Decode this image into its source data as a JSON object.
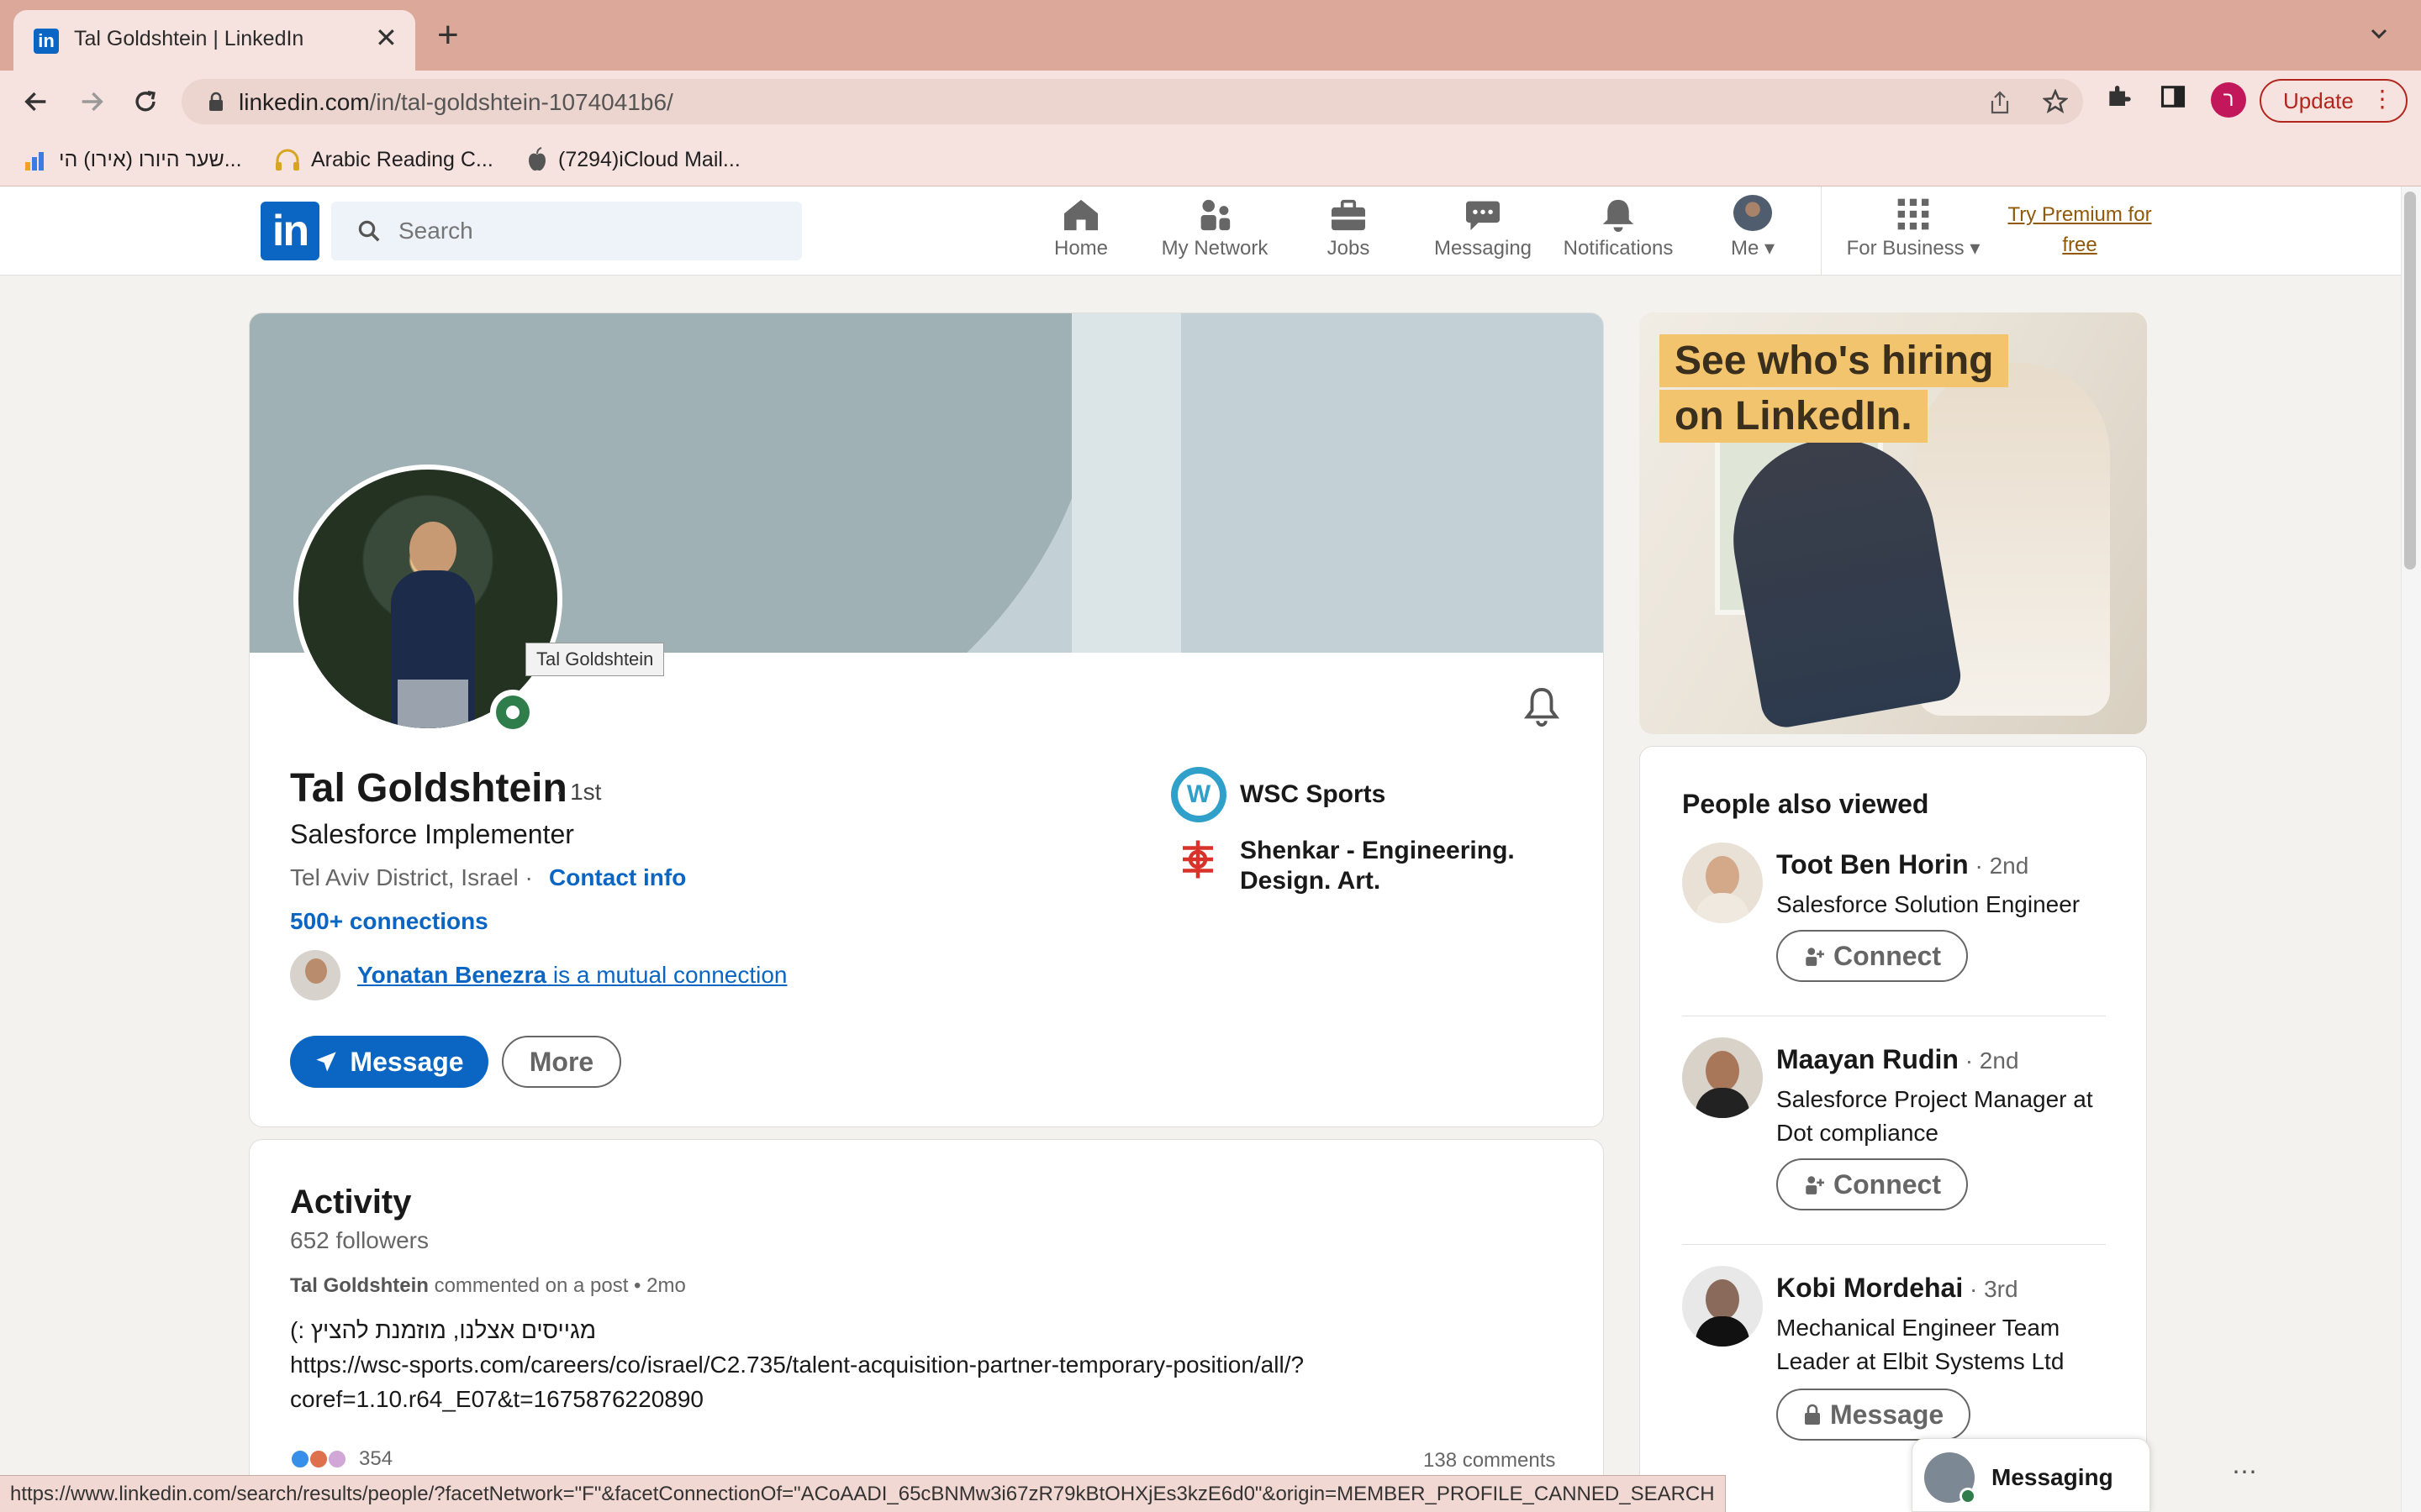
{
  "browser": {
    "tab_title": "Tal Goldshtein | LinkedIn",
    "tab_favicon": "in",
    "url_host": "linkedin.com",
    "url_path": "/in/tal-goldshtein-1074041b6/",
    "profile_initial": "ר",
    "update_label": "Update",
    "bookmarks": [
      {
        "label": "שער היורו (אירו) הי...",
        "icon": "bar-chart-icon"
      },
      {
        "label": "Arabic Reading C...",
        "icon": "headphones-icon"
      },
      {
        "label": "(7294)iCloud Mail...",
        "icon": "apple-icon"
      }
    ],
    "status_url": "https://www.linkedin.com/search/results/people/?facetNetwork=\"F\"&facetConnectionOf=\"ACoAADI_65cBNMw3i67zR79kBtOHXjEs3kzE6d0\"&origin=MEMBER_PROFILE_CANNED_SEARCH"
  },
  "nav": {
    "logo": "in",
    "search_placeholder": "Search",
    "items": {
      "home": "Home",
      "network": "My Network",
      "jobs": "Jobs",
      "messaging": "Messaging",
      "notifications": "Notifications",
      "me": "Me",
      "business": "For Business"
    },
    "premium_line1": "Try Premium for",
    "premium_line2": "free"
  },
  "profile": {
    "tooltip": "Tal Goldshtein",
    "name": "Tal Goldshtein",
    "degree": "· 1st",
    "headline": "Salesforce Implementer",
    "location": "Tel Aviv District, Israel ·",
    "contact_info": "Contact info",
    "connections": "500+ connections",
    "mutual_name": "Yonatan Benezra",
    "mutual_suffix": " is a mutual connection",
    "message_label": "Message",
    "more_label": "More",
    "company": "WSC Sports",
    "school": "Shenkar - Engineering. Design. Art."
  },
  "activity": {
    "title": "Activity",
    "followers": "652 followers",
    "post_author": "Tal Goldshtein",
    "post_action": " commented on a post • 2mo",
    "post_line1": "מגייסים אצלנו, מוזמנת להציץ :)",
    "post_line2": "https://wsc-sports.com/careers/co/israel/C2.735/talent-acquisition-partner-temporary-position/all/?",
    "post_line3": "coref=1.10.r64_E07&t=1675876220890",
    "reactions_count": "354",
    "comments": "138 comments"
  },
  "ad": {
    "line1": "See who's hiring",
    "line2": "on LinkedIn."
  },
  "people_also_viewed": {
    "title": "People also viewed",
    "people": [
      {
        "name": "Toot Ben Horin",
        "degree": " · 2nd",
        "headline": "Salesforce Solution Engineer",
        "action": "Connect"
      },
      {
        "name": "Maayan Rudin",
        "degree": " · 2nd",
        "headline": "Salesforce Project Manager at Dot compliance",
        "action": "Connect"
      },
      {
        "name": "Kobi Mordehai",
        "degree": " · 3rd",
        "headline": "Mechanical Engineer Team Leader at Elbit Systems Ltd",
        "action": "Message"
      }
    ]
  },
  "messaging_widget": {
    "label": "Messaging"
  },
  "colors": {
    "linkedin_blue": "#0a66c2",
    "tabbar": "#dca89a",
    "online_green": "#2f7d4a",
    "premium": "#915907"
  }
}
